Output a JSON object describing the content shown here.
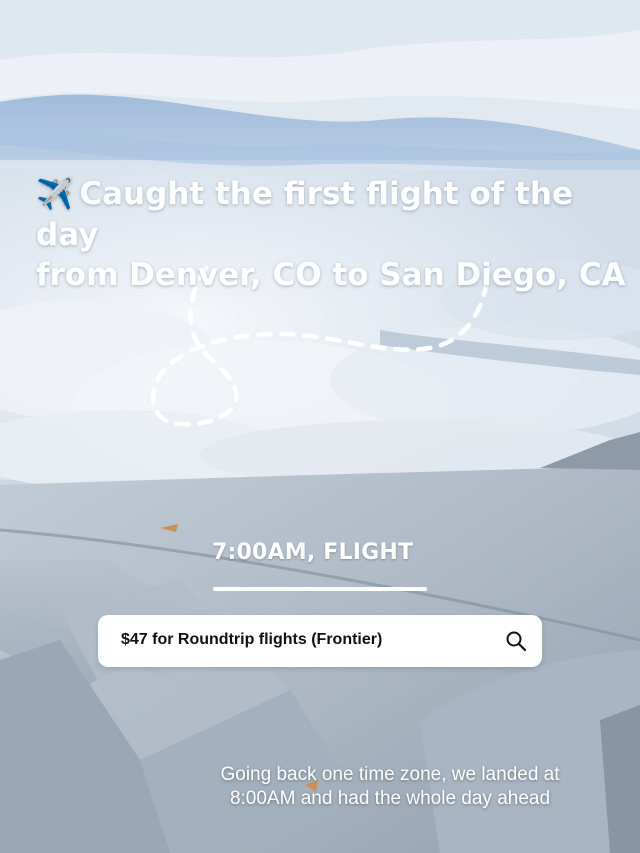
{
  "headline": {
    "emoji": "✈️",
    "line1": "Caught the first flight of the day",
    "line2": "from Denver, CO to San Diego, CA"
  },
  "time_label": "7:00AM, FLIGHT",
  "search": {
    "text": "$47 for Roundtrip flights (Frontier)",
    "icon": "search-icon"
  },
  "caption": {
    "line1": "Going back one time zone, we landed at",
    "line2": "8:00AM and had the whole day ahead"
  },
  "colors": {
    "text": "#ffffff",
    "sky": "#8fb1d6",
    "wing": "#a9b7c5"
  }
}
